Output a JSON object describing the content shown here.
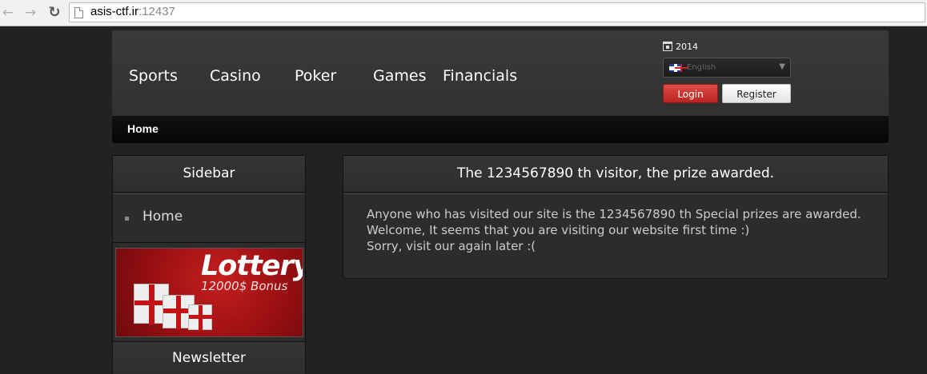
{
  "browser": {
    "url_host": "asis-ctf.ir",
    "url_port": ":12437"
  },
  "header": {
    "menu": [
      "Sports",
      "Casino",
      "Poker",
      "Games",
      "Financials"
    ],
    "year": "2014",
    "language": "English",
    "login_label": "Login",
    "register_label": "Register"
  },
  "subnav": {
    "home_label": "Home"
  },
  "sidebar": {
    "title": "Sidebar",
    "items": [
      {
        "label": "Home"
      }
    ],
    "banner_title": "Lottery",
    "banner_bonus": "12000$ Bonus",
    "newsletter_title": "Newsletter"
  },
  "main": {
    "title": "The 1234567890 th visitor, the prize awarded.",
    "lines": [
      "Anyone who has visited our site is the 1234567890 th Special prizes are awarded.",
      "Welcome, It seems that you are visiting our website first time :)",
      "Sorry, visit our again later :("
    ]
  },
  "colors": {
    "page_background": "#222222",
    "login_button": "#cc3431",
    "header_background": "#353535"
  }
}
